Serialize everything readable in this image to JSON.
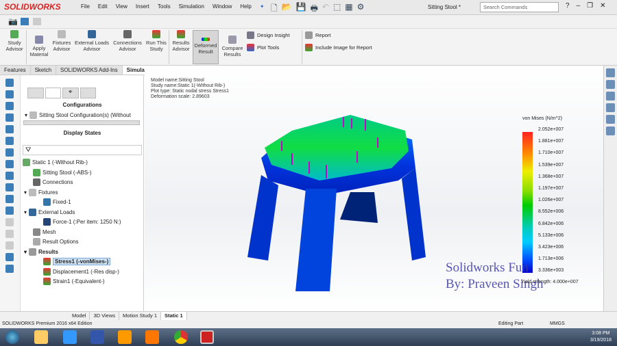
{
  "app": {
    "logo": "SOLIDWORKS",
    "menu": [
      "File",
      "Edit",
      "View",
      "Insert",
      "Tools",
      "Simulation",
      "Window",
      "Help"
    ],
    "config_name": "Sitting Stool *",
    "search_placeholder": "Search Commands"
  },
  "ribbon": {
    "study_advisor": "Study Advisor",
    "apply_material": "Apply Material",
    "fixtures_advisor": "Fixtures Advisor",
    "external_loads_advisor": "External Loads Advisor",
    "connections_advisor": "Connections Advisor",
    "run_study": "Run This Study",
    "results_advisor": "Results Advisor",
    "deformed_result": "Deformed Result",
    "compare_results": "Compare Results",
    "design_insight": "Design Insight",
    "plot_tools": "Plot Tools",
    "report": "Report",
    "include_image": "Include Image for Report"
  },
  "tabs": [
    "Features",
    "Sketch",
    "SOLIDWORKS Add-Ins",
    "Simulation"
  ],
  "panel": {
    "configurations": "Configurations",
    "config_item": "Sitting Stool Configuration(s)  (Without",
    "display_states": "Display States",
    "tree": [
      "Static 1 (-Without Rib-)",
      "Sitting Stool (-ABS-)",
      "Connections",
      "Fixtures",
      "Fixed-1",
      "External Loads",
      "Force-1 (:Per item: 1250 N:)",
      "Mesh",
      "Result Options",
      "Results",
      "Stress1 (-vonMises-)",
      "Displacement1 (-Res disp-)",
      "Strain1 (-Equivalent-)"
    ]
  },
  "plot_info": {
    "model": "Model name:Sitting Stool",
    "study": "Study name:Static 1(-Without Rib-)",
    "plot_type": "Plot type: Static nodal stress Stress1",
    "scale": "Deformation scale: 2.89603"
  },
  "legend": {
    "title": "von Mises (N/m^2)",
    "labels": [
      "2.052e+007",
      "1.881e+007",
      "1.710e+007",
      "1.539e+007",
      "1.368e+007",
      "1.197e+007",
      "1.026e+007",
      "8.552e+006",
      "6.842e+006",
      "5.133e+006",
      "3.423e+006",
      "1.713e+006",
      "3.336e+003"
    ],
    "yield": "Yield strength: 4.000e+007"
  },
  "watermark": [
    "Solidworks Fun",
    "By: Praveen Singh"
  ],
  "bottom_tabs": [
    "Model",
    "3D Views",
    "Motion Study 1",
    "Static 1"
  ],
  "status": {
    "edition": "SOLIDWORKS Premium 2016 x64 Edition",
    "mode": "Editing Part",
    "units": "MMGS"
  },
  "clock": {
    "time": "3:08 PM",
    "date": "3/19/2018"
  }
}
